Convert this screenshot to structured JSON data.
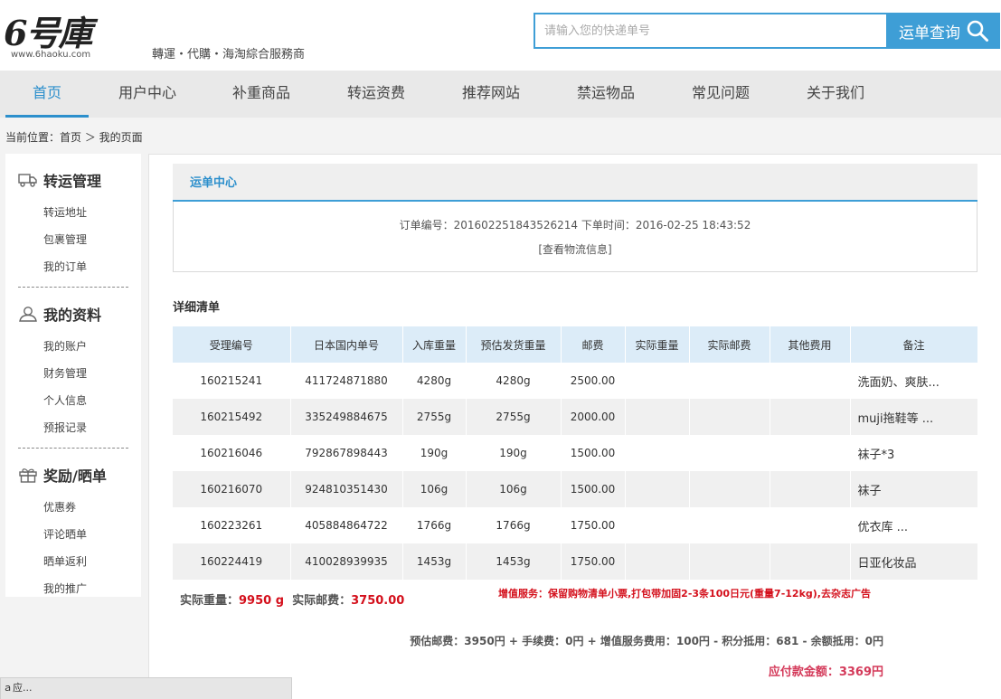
{
  "header": {
    "logo_mark": "6号庫",
    "logo_url": "www.6haoku.com",
    "slogan": "轉運・代購・海淘綜合服務商",
    "search_placeholder": "请输入您的快递单号",
    "search_button": "运单查询"
  },
  "nav": [
    "首页",
    "用户中心",
    "补重商品",
    "转运资费",
    "推荐网站",
    "禁运物品",
    "常见问题",
    "关于我们"
  ],
  "breadcrumb": "当前位置：首页 ＞ 我的页面",
  "sidebar": {
    "groups": [
      {
        "title": "转运管理",
        "icon": "truck-icon",
        "items": [
          "转运地址",
          "包裹管理",
          "我的订单"
        ]
      },
      {
        "title": "我的资料",
        "icon": "user-icon",
        "items": [
          "我的账户",
          "财务管理",
          "个人信息",
          "预报记录"
        ]
      },
      {
        "title": "奖励/晒单",
        "icon": "gift-icon",
        "items": [
          "优惠券",
          "评论晒单",
          "晒单返利",
          "我的推广"
        ]
      }
    ]
  },
  "order": {
    "tab": "运单中心",
    "info": "订单编号：201602251843526214  下单时间：2016-02-25 18:43:52",
    "logistics_link": "[查看物流信息]"
  },
  "detail": {
    "title": "详细清单",
    "columns": [
      "受理编号",
      "日本国内单号",
      "入库重量",
      "预估发货重量",
      "邮费",
      "实际重量",
      "实际邮费",
      "其他费用",
      "备注"
    ],
    "rows": [
      [
        "160215241",
        "411724871880",
        "4280g",
        "4280g",
        "2500.00",
        "",
        "",
        "",
        "洗面奶、爽肤..."
      ],
      [
        "160215492",
        "335249884675",
        "2755g",
        "2755g",
        "2000.00",
        "",
        "",
        "",
        "muji拖鞋等 ..."
      ],
      [
        "160216046",
        "792867898443",
        "190g",
        "190g",
        "1500.00",
        "",
        "",
        "",
        "袜子*3"
      ],
      [
        "160216070",
        "924810351430",
        "106g",
        "106g",
        "1500.00",
        "",
        "",
        "",
        "袜子"
      ],
      [
        "160223261",
        "405884864722",
        "1766g",
        "1766g",
        "1750.00",
        "",
        "",
        "",
        "优衣库 ..."
      ],
      [
        "160224419",
        "410028939935",
        "1453g",
        "1453g",
        "1750.00",
        "",
        "",
        "",
        "日亚化妆品"
      ]
    ]
  },
  "summary": {
    "weight_label": "实际重量：",
    "weight_value": "9950 g",
    "postage_label": "实际邮费：",
    "postage_value": "3750.00",
    "service": "增值服务：保留购物清单小票,打包带加固2-3条100日元(重量7-12kg),去杂志广告",
    "fee_line": "预估邮费：3950円 + 手续费：0円 + 增值服务费用：100円 - 积分抵用：681 - 余额抵用：0円",
    "payable": "应付款金额：3369円"
  },
  "statusbar": "ａ应..."
}
